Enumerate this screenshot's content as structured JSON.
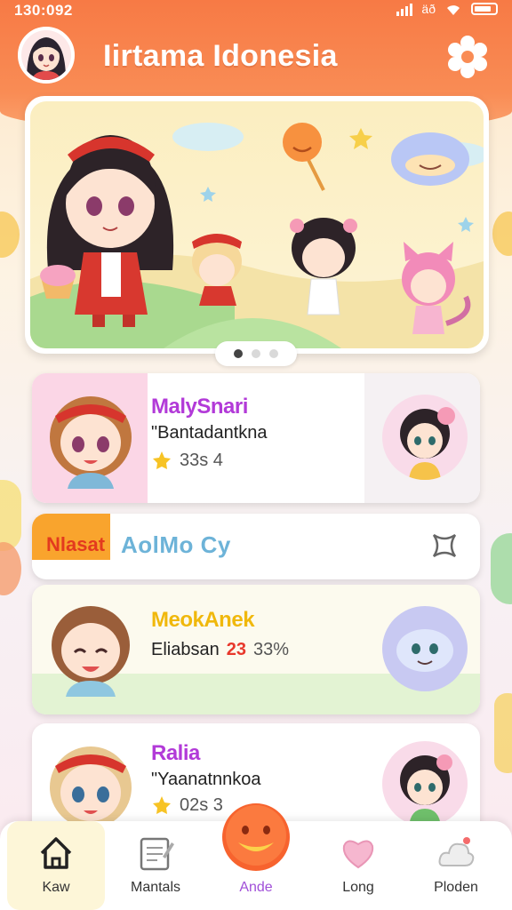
{
  "status_bar": {
    "time": "130:092",
    "carrier": "äð"
  },
  "header": {
    "title": "Iirtama Idonesia"
  },
  "hero": {
    "page_count": 3,
    "active_index": 0
  },
  "cards": [
    {
      "name": "MalySnari",
      "subtitle": "\"Bantadantkna",
      "rating": "33s 4"
    },
    {
      "tag": "Nlasat",
      "title": "AolMo Cy"
    },
    {
      "name": "MeokAnek",
      "subtitle": "Eliabsan",
      "badge": "23",
      "percent": "33%"
    },
    {
      "name": "Ralia",
      "subtitle": "\"Yaanatnnkoa",
      "rating": "02s 3"
    }
  ],
  "nav": {
    "items": [
      {
        "label": "Kaw"
      },
      {
        "label": "Mantals"
      },
      {
        "label": "Ande"
      },
      {
        "label": "Long"
      },
      {
        "label": "Ploden"
      }
    ]
  },
  "colors": {
    "header": "#f77a45",
    "purple_name": "#b23ad8",
    "yellow_name": "#f0b80c",
    "accent_red": "#e8382c"
  }
}
